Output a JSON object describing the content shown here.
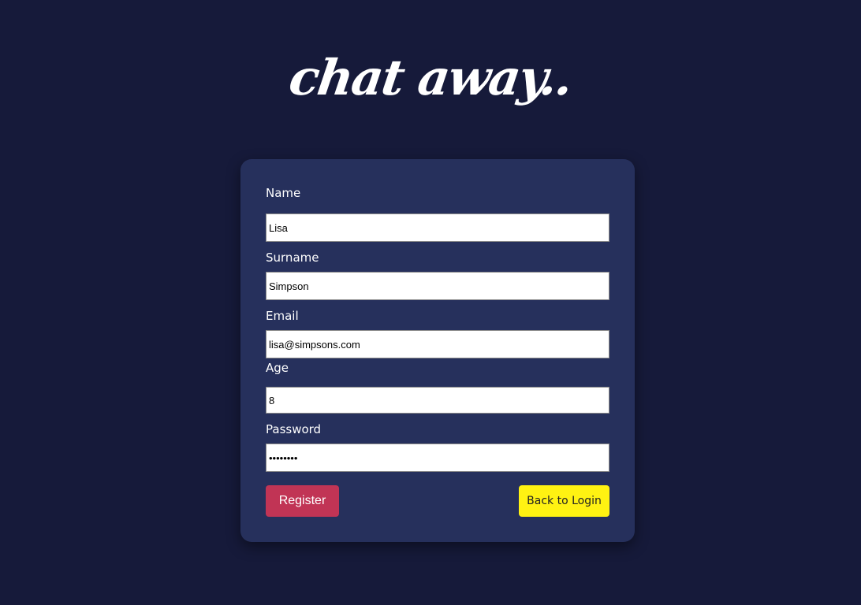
{
  "app": {
    "logo_text": "chat away.."
  },
  "form": {
    "fields": [
      {
        "label": "Name",
        "value": "Lisa",
        "type": "text"
      },
      {
        "label": "Surname",
        "value": "Simpson",
        "type": "text"
      },
      {
        "label": "Email",
        "value": "lisa@simpsons.com",
        "type": "email"
      },
      {
        "label": "Age",
        "value": "8",
        "type": "number"
      },
      {
        "label": "Password",
        "value": "••••••••",
        "type": "password"
      }
    ],
    "register_label": "Register",
    "back_label": "Back to Login"
  },
  "colors": {
    "page_bg": "#161a3a",
    "card_bg": "#26305c",
    "register_bg": "#c13455",
    "back_bg": "#fff212"
  }
}
